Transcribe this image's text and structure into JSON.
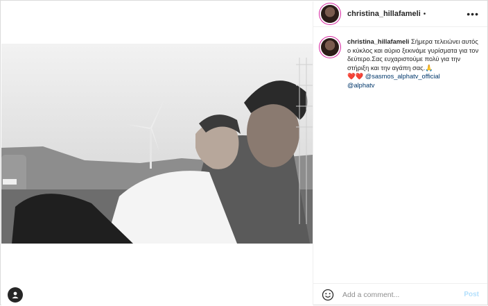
{
  "post": {
    "username": "christina_hillafameli",
    "dot": "•",
    "more": "•••"
  },
  "caption": {
    "username": "christina_hillafameli",
    "line1": " Σήμερα τελειώνει αυτός ο κύκλος και αύριο ξεκινάμε γυρίσματα για τον δεύτερο.Σας ευχαριστούμε πολύ για την στήριξη και την αγάπη σας.🙏",
    "hearts": "❤️❤️",
    "mention1": "@sasmos_alphatv_official",
    "mention2": "@alphatv"
  },
  "comment": {
    "placeholder": "Add a comment...",
    "post_label": "Post"
  },
  "icons": {
    "tag": "user-tag-icon",
    "emoji": "emoji-icon",
    "more": "more-options-icon"
  }
}
